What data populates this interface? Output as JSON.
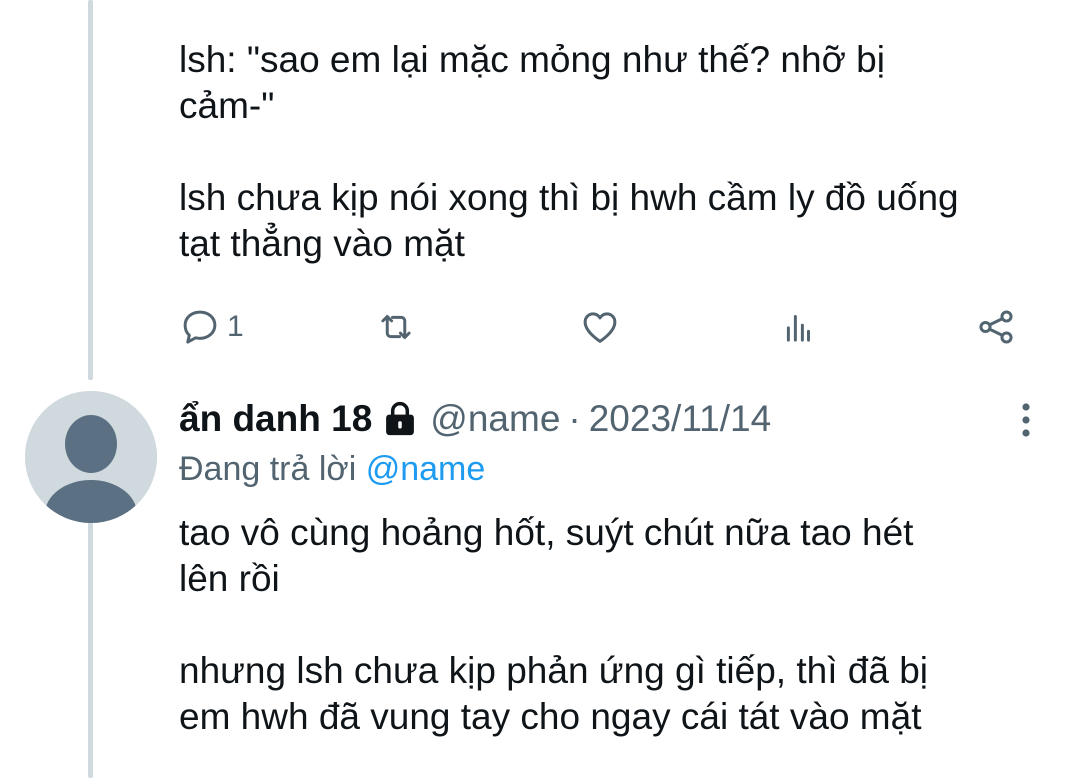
{
  "previous_tweet": {
    "text": "lsh: \"sao em lại mặc mỏng như thế? nhỡ bị\ncảm-\"\n\nlsh chưa kịp nói xong thì bị hwh cầm ly đồ uống\ntạt thẳng vào mặt",
    "actions": {
      "reply_count": "1",
      "icons": [
        "reply-icon",
        "retweet-icon",
        "like-icon",
        "views-icon",
        "share-icon"
      ]
    }
  },
  "reply_tweet": {
    "display_name": "ẩn danh 18",
    "handle": "@name",
    "separator": "·",
    "date": "2023/11/14",
    "replying_prefix": "Đang trả lời",
    "replying_handle": "@name",
    "text": "tao vô cùng hoảng hốt, suýt chút nữa tao hét\nlên rồi\n\nnhưng lsh chưa kịp phản ứng gì tiếp, thì đã bị\nem hwh đã vung tay cho ngay cái tát vào mặt",
    "icons": [
      "avatar-placeholder-icon",
      "lock-icon",
      "more-options-icon"
    ]
  },
  "colors": {
    "text": "#0f1419",
    "secondary": "#536471",
    "link": "#1d9bf0",
    "thread_line": "#cfd9de",
    "avatar_bg": "#cfd9de",
    "avatar_fg": "#5b7083"
  }
}
